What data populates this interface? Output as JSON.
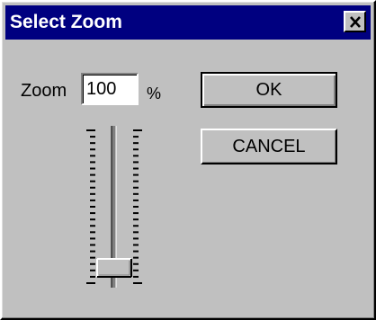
{
  "window": {
    "title": "Select Zoom"
  },
  "zoom": {
    "label": "Zoom",
    "value": "100",
    "unit": "%"
  },
  "buttons": {
    "ok_label": "OK",
    "cancel_label": "CANCEL"
  },
  "slider": {
    "orientation": "vertical",
    "level_fraction": 0.1
  },
  "colors": {
    "titlebar": "#000080",
    "face": "#c0c0c0"
  },
  "icons": {
    "close": "close-icon"
  }
}
